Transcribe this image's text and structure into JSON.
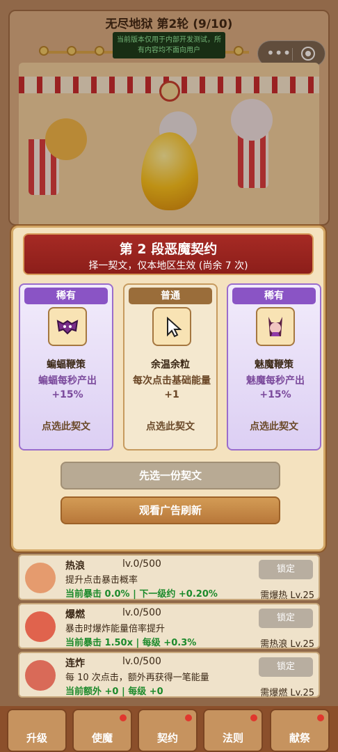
{
  "header": {
    "title": "无尽地狱 第2轮 (9/10)",
    "notice": "当前版本仅用于内部开发测试，所有内容均不面向用户"
  },
  "capsule": {
    "more_icon": "more-dots-icon",
    "target_icon": "target-icon"
  },
  "modal": {
    "title": "第 2 段恶魔契约",
    "subtitle": "择一契文，仅本地区生效 (尚余 7 次)",
    "cards": [
      {
        "badge": "稀有",
        "name": "蝙蝠鞭策",
        "desc": "蝙蝠每秒产出+15%",
        "pick": "点选此契文",
        "icon": "bat-icon"
      },
      {
        "badge": "普通",
        "name": "余温余粒",
        "desc": "每次点击基础能量 +1",
        "pick": "点选此契文",
        "icon": "cursor-icon"
      },
      {
        "badge": "稀有",
        "name": "魅魔鞭策",
        "desc": "魅魔每秒产出+15%",
        "pick": "点选此契文",
        "icon": "succubus-icon"
      }
    ],
    "choose_first": "先选一份契文",
    "watch_ad": "观看广告刷新"
  },
  "upgrades": [
    {
      "name": "热浪",
      "level": "lv.0/500",
      "desc": "提升点击暴击概率",
      "current": "当前暴击 0.0% | 下一级约 +0.20%",
      "button": "锁定",
      "req": "需爆热 Lv.25"
    },
    {
      "name": "爆燃",
      "level": "lv.0/500",
      "desc": "暴击时爆炸能量倍率提升",
      "current": "当前暴击 1.50x | 每级 +0.3%",
      "button": "锁定",
      "req": "需热浪 Lv.25"
    },
    {
      "name": "连炸",
      "level": "lv.0/500",
      "desc": "每 10 次点击，额外再获得一笔能量",
      "current": "当前额外 +0 | 每级 +0",
      "button": "锁定",
      "req": "需爆燃 Lv.25"
    }
  ],
  "tabs": [
    {
      "label": "升级",
      "dot": false
    },
    {
      "label": "使魔",
      "dot": true
    },
    {
      "label": "契约",
      "dot": true
    },
    {
      "label": "法则",
      "dot": true
    },
    {
      "label": "献祭",
      "dot": true
    }
  ]
}
